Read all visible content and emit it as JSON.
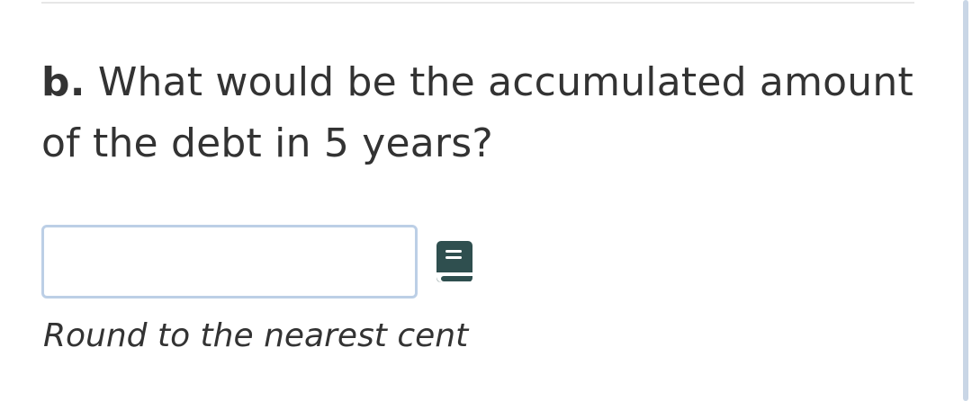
{
  "question": {
    "part_label": "b.",
    "text": "What would be the accumulated amount of the debt in 5 years?"
  },
  "answer": {
    "value": "",
    "placeholder": ""
  },
  "hint": {
    "text": "Round to the nearest cent"
  },
  "icons": {
    "reference": "book-icon"
  },
  "colors": {
    "text": "#333333",
    "input_border": "#bccfe6",
    "icon": "#2f4f4f",
    "scrollbar": "#c9d6e6"
  }
}
